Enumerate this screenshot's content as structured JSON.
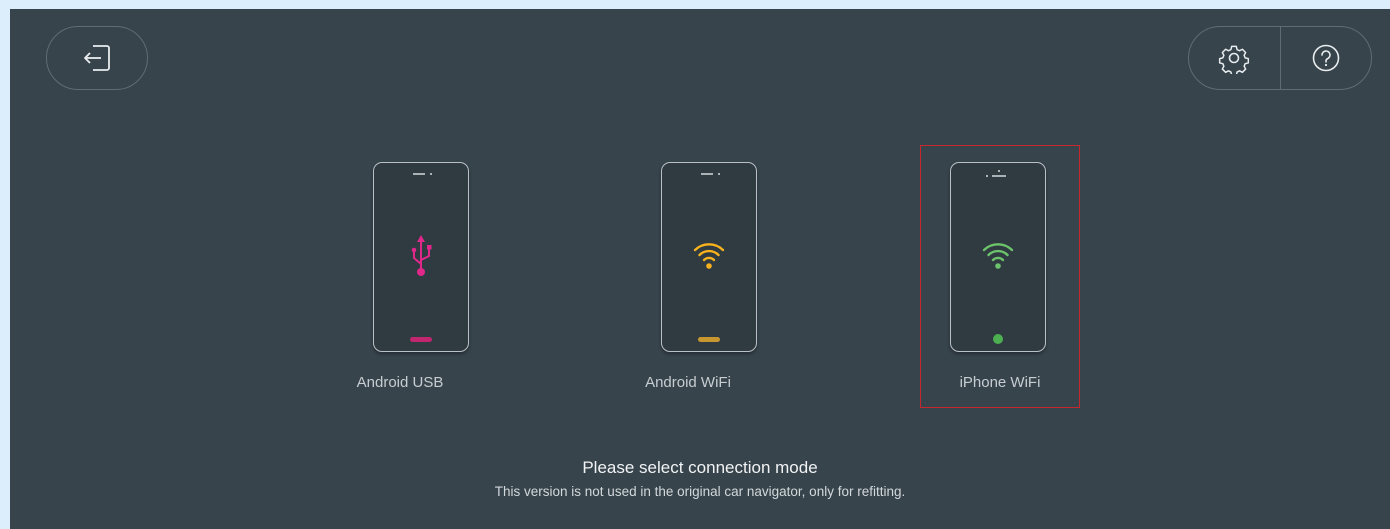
{
  "header": {
    "exit_icon": "exit-icon",
    "settings_icon": "gear-icon",
    "help_icon": "help-icon"
  },
  "modes": [
    {
      "label": "Android USB",
      "icon": "usb-icon",
      "accent": "#e0288a",
      "selected": false
    },
    {
      "label": "Android WiFi",
      "icon": "wifi-icon",
      "accent": "#f7b21e",
      "selected": false
    },
    {
      "label": "iPhone WiFi",
      "icon": "wifi-icon",
      "accent": "#6cc36b",
      "selected": true
    }
  ],
  "footer": {
    "title": "Please select connection mode",
    "subtitle": "This version is not used in the original car navigator, only for refitting."
  },
  "colors": {
    "background": "#37444c",
    "selection_outline": "#c8262e",
    "usb_accent": "#e0288a",
    "android_wifi_accent": "#f7b21e",
    "iphone_wifi_accent": "#6cc36b"
  }
}
